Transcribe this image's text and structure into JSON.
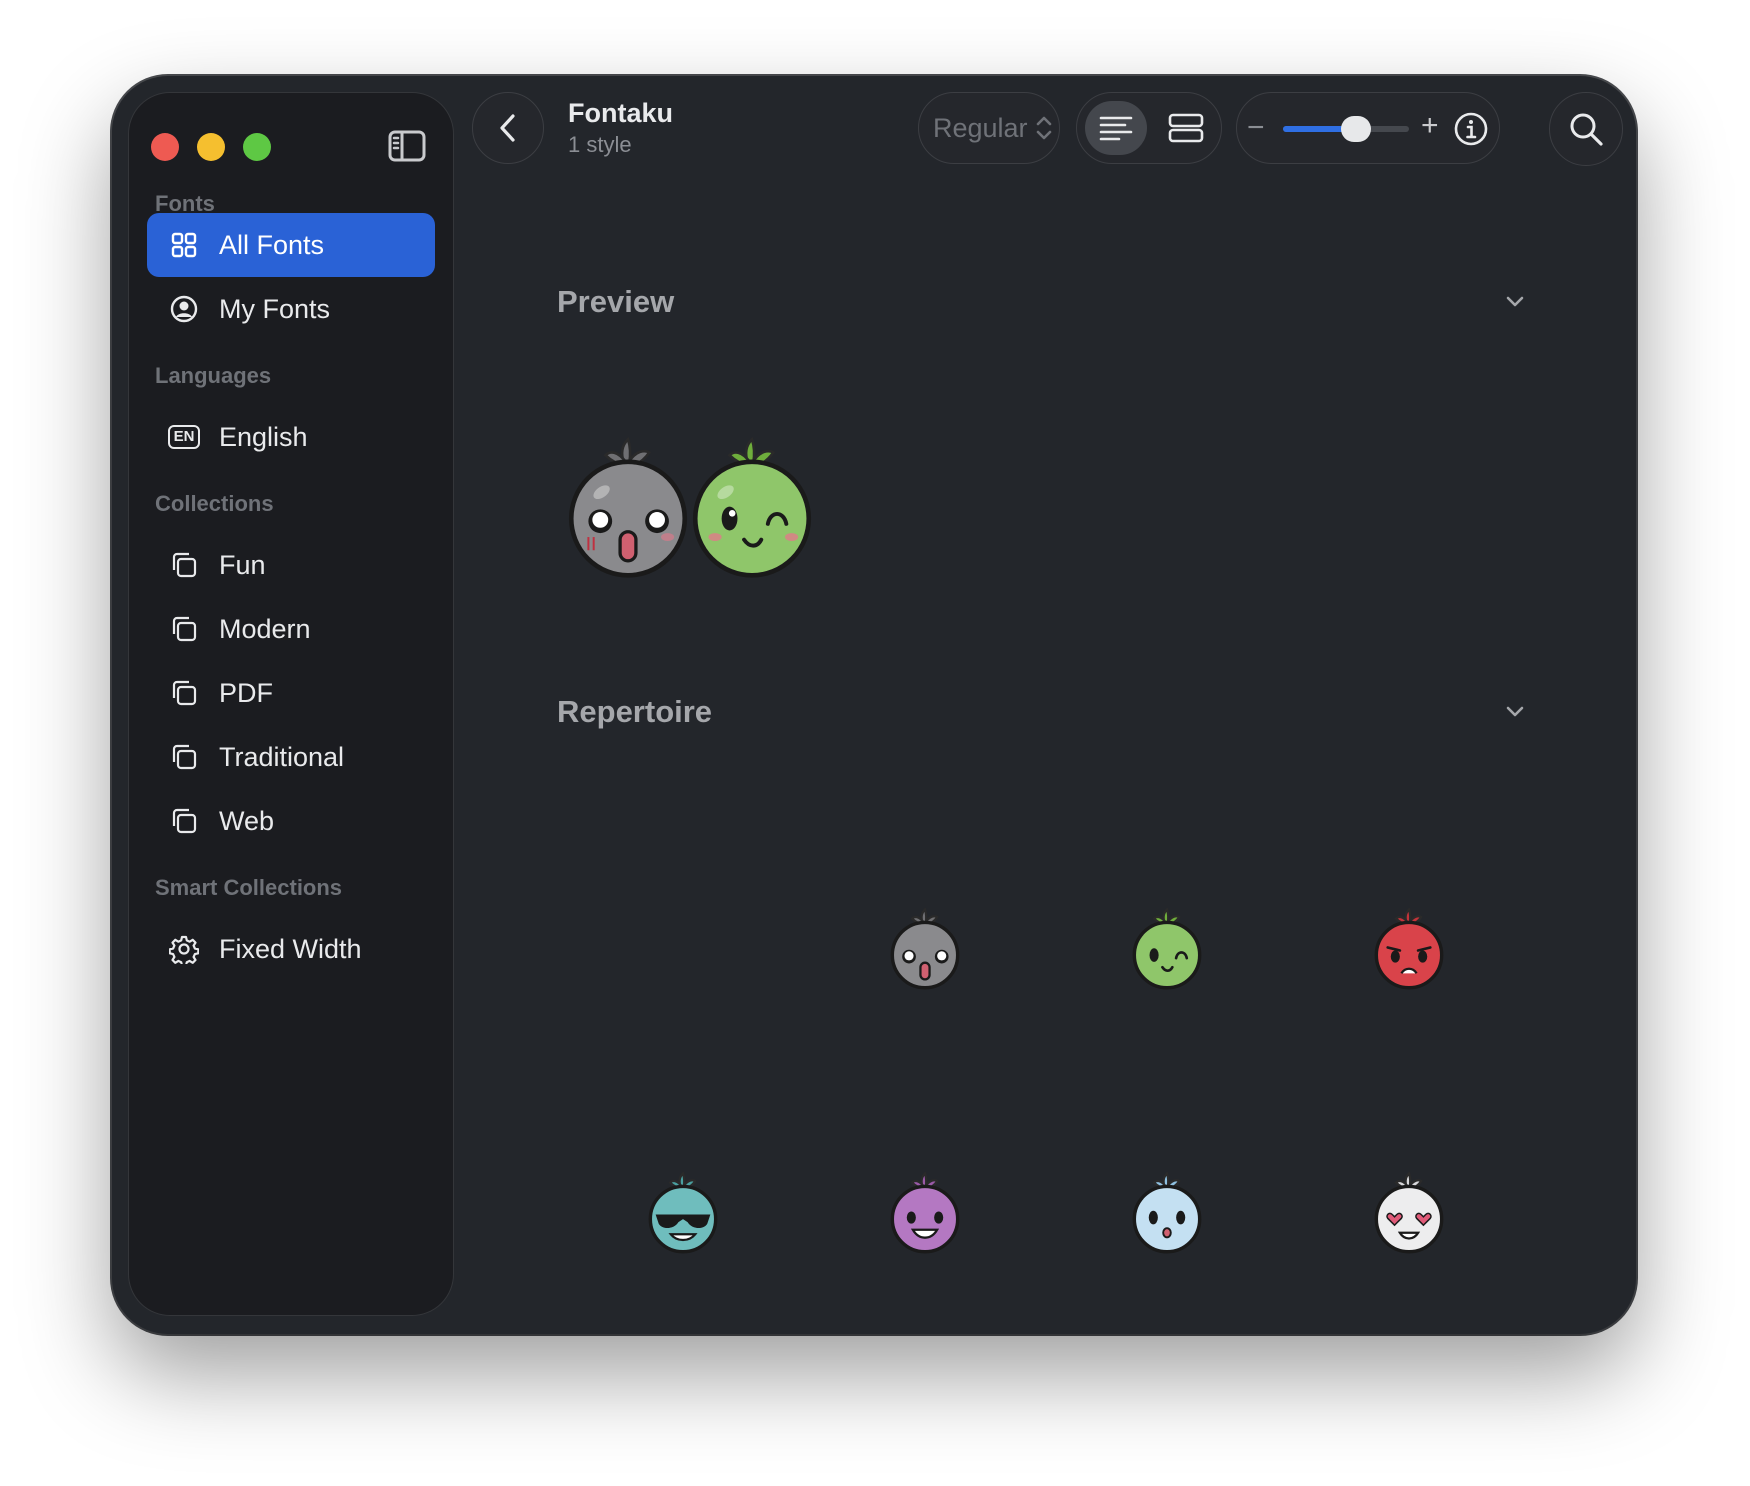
{
  "window": {
    "traffic_lights": [
      "close",
      "minimize",
      "zoom"
    ]
  },
  "toolbar": {
    "title": "Fontaku",
    "subtitle": "1 style",
    "style_select": "Regular",
    "zoom_minus": "−",
    "zoom_plus": "+",
    "zoom_level": 0.58
  },
  "sidebar": {
    "sections": [
      {
        "heading": "Fonts",
        "items": [
          {
            "label": "All Fonts",
            "icon": "grid-icon",
            "selected": true
          },
          {
            "label": "My Fonts",
            "icon": "person-circle-icon",
            "selected": false
          }
        ]
      },
      {
        "heading": "Languages",
        "items": [
          {
            "label": "English",
            "icon": "en-badge-icon",
            "icon_text": "EN",
            "selected": false
          }
        ]
      },
      {
        "heading": "Collections",
        "items": [
          {
            "label": "Fun",
            "icon": "collection-icon",
            "selected": false
          },
          {
            "label": "Modern",
            "icon": "collection-icon",
            "selected": false
          },
          {
            "label": "PDF",
            "icon": "collection-icon",
            "selected": false
          },
          {
            "label": "Traditional",
            "icon": "collection-icon",
            "selected": false
          },
          {
            "label": "Web",
            "icon": "collection-icon",
            "selected": false
          }
        ]
      },
      {
        "heading": "Smart Collections",
        "items": [
          {
            "label": "Fixed Width",
            "icon": "gear-icon",
            "selected": false
          }
        ]
      }
    ]
  },
  "main": {
    "preview": {
      "heading": "Preview",
      "glyphs": [
        "gray-surprised",
        "green-winking"
      ]
    },
    "repertoire": {
      "heading": "Repertoire",
      "glyphs": [
        "empty",
        "gray-surprised",
        "green-winking",
        "red-angry",
        "teal-sunglasses",
        "purple-grinning",
        "lightblue-shy",
        "white-heart-eyes"
      ]
    }
  },
  "colors": {
    "accent": "#2a62d6",
    "window_bg": "#23262b",
    "sidebar_bg": "#1b1c20",
    "close": "#ee5a52",
    "minimize": "#f5bf2f",
    "zoom": "#5ec844"
  }
}
